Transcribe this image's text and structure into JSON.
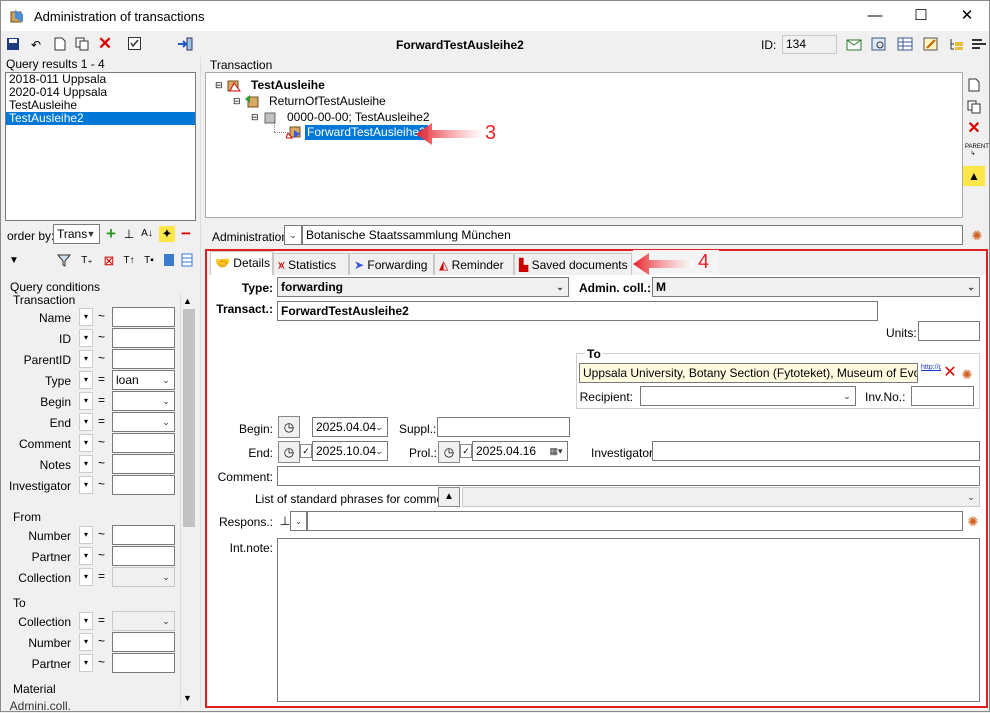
{
  "window": {
    "title": "Administration of transactions",
    "minimize": "—",
    "maximize": "☐",
    "close": "✕"
  },
  "toolbar": {
    "header_title": "ForwardTestAusleihe2",
    "id_label": "ID:",
    "id_value": "134"
  },
  "query_results": {
    "header": "Query results  1 - 4",
    "items": [
      "2018-011 Uppsala",
      "2020-014 Uppsala",
      "TestAusleihe",
      "TestAusleihe2"
    ],
    "selected_index": 3
  },
  "order_by": {
    "label": "order by:",
    "value": "Trans"
  },
  "query_conditions": {
    "header": "Query conditions",
    "transaction_group": "Transaction",
    "transaction_rows": [
      {
        "label": "Name",
        "op": "~",
        "value": ""
      },
      {
        "label": "ID",
        "op": "~",
        "value": ""
      },
      {
        "label": "ParentID",
        "op": "~",
        "value": ""
      },
      {
        "label": "Type",
        "op": "=",
        "value": "loan"
      },
      {
        "label": "Begin",
        "op": "=",
        "value": ""
      },
      {
        "label": "End",
        "op": "=",
        "value": ""
      },
      {
        "label": "Comment",
        "op": "~",
        "value": ""
      },
      {
        "label": "Notes",
        "op": "~",
        "value": ""
      },
      {
        "label": "Investigator",
        "op": "~",
        "value": ""
      }
    ],
    "from_group": "From",
    "from_rows": [
      {
        "label": "Number",
        "op": "~"
      },
      {
        "label": "Partner",
        "op": "~"
      },
      {
        "label": "Collection",
        "op": "="
      }
    ],
    "to_group": "To",
    "to_rows": [
      {
        "label": "Collection",
        "op": "="
      },
      {
        "label": "Number",
        "op": "~"
      },
      {
        "label": "Partner",
        "op": "~"
      }
    ],
    "material_group": "Material",
    "material_row": "Admini.coll."
  },
  "transaction_tree": {
    "header": "Transaction",
    "nodes": [
      "TestAusleihe",
      "ReturnOfTestAusleihe",
      "0000-00-00; TestAusleihe2",
      "ForwardTestAusleihe2"
    ]
  },
  "administration": {
    "label": "Administration:",
    "value": "Botanische Staatssammlung München"
  },
  "tabs": [
    "Details",
    "Statistics",
    "Forwarding",
    "Reminder",
    "Saved documents"
  ],
  "details": {
    "type_label": "Type:",
    "type_value": "forwarding",
    "admin_coll_label": "Admin. coll.:",
    "admin_coll_value": "M",
    "transact_label": "Transact.:",
    "transact_value": "ForwardTestAusleihe2",
    "units_label": "Units:",
    "to_group": "To",
    "to_value": "Uppsala University, Botany Section (Fytoteket), Museum of Evolution, H",
    "to_link": "http://grains",
    "recipient_label": "Recipient:",
    "invno_label": "Inv.No.:",
    "begin_label": "Begin:",
    "begin_value": "2025.04.04",
    "suppl_label": "Suppl.:",
    "end_label": "End:",
    "end_value": "2025.10.04",
    "prol_label": "Prol.:",
    "prol_value": "2025.04.16",
    "investigator_label": "Investigator:",
    "comment_label": "Comment:",
    "phrases_label": "List of standard phrases for comment:",
    "respons_label": "Respons.:",
    "intnote_label": "Int.note:"
  },
  "callouts": {
    "tree": "3",
    "tabs": "4"
  },
  "colors": {
    "accent": "#0078d7",
    "callout": "#e8202a",
    "highlight_frame": "#e02020"
  }
}
